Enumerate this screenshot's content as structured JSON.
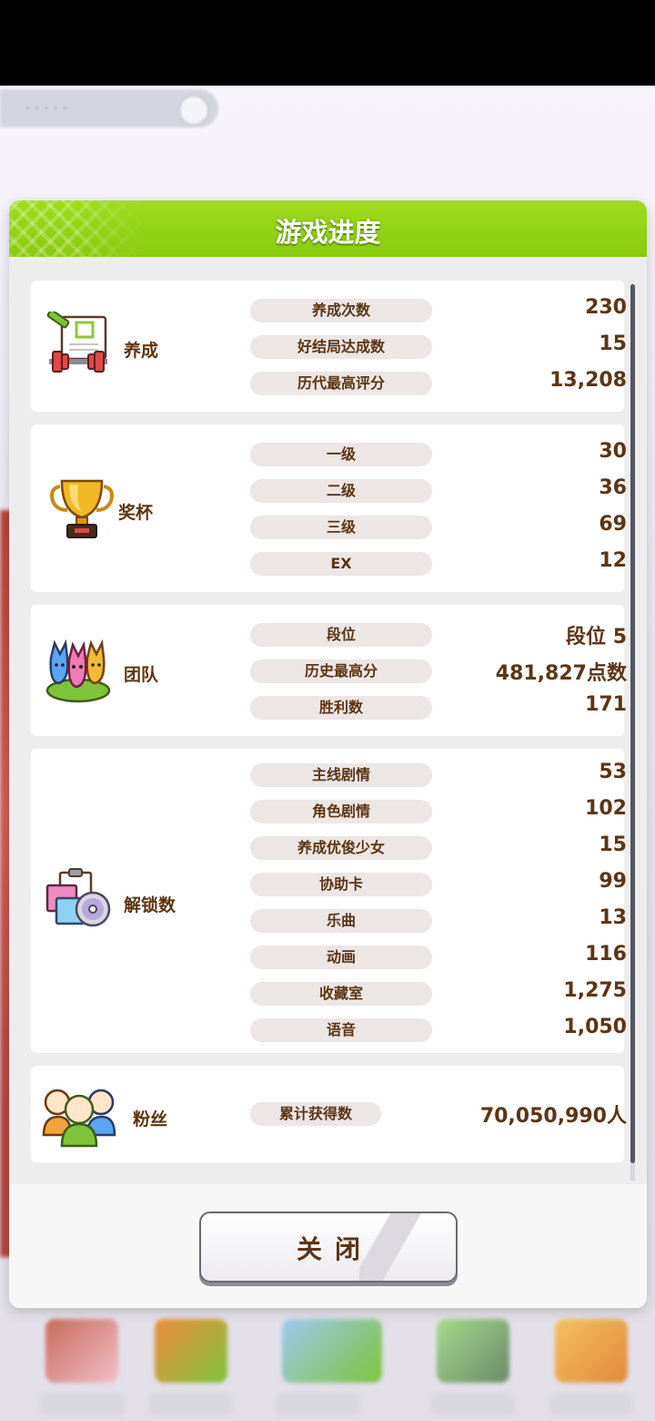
{
  "modal": {
    "title": "游戏进度",
    "close_label": "关闭"
  },
  "sections": [
    {
      "id": "training",
      "label": "养成",
      "icon": "training-icon",
      "rows": [
        {
          "label": "养成次数",
          "value": "230"
        },
        {
          "label": "好结局达成数",
          "value": "15"
        },
        {
          "label": "历代最高评分",
          "value": "13,208"
        }
      ]
    },
    {
      "id": "trophy",
      "label": "奖杯",
      "icon": "trophy-icon",
      "rows": [
        {
          "label": "一级",
          "value": "30"
        },
        {
          "label": "二级",
          "value": "36"
        },
        {
          "label": "三级",
          "value": "69"
        },
        {
          "label": "EX",
          "value": "12"
        }
      ]
    },
    {
      "id": "team",
      "label": "团队",
      "icon": "team-icon",
      "rows": [
        {
          "label": "段位",
          "value": "段位 5"
        },
        {
          "label": "历史最高分",
          "value": "481,827点数"
        },
        {
          "label": "胜利数",
          "value": "171"
        }
      ]
    },
    {
      "id": "unlocks",
      "label": "解锁数",
      "icon": "unlock-icon",
      "rows": [
        {
          "label": "主线剧情",
          "value": "53"
        },
        {
          "label": "角色剧情",
          "value": "102"
        },
        {
          "label": "养成优俊少女",
          "value": "15"
        },
        {
          "label": "协助卡",
          "value": "99"
        },
        {
          "label": "乐曲",
          "value": "13"
        },
        {
          "label": "动画",
          "value": "116"
        },
        {
          "label": "收藏室",
          "value": "1,275"
        },
        {
          "label": "语音",
          "value": "1,050"
        }
      ]
    },
    {
      "id": "fans",
      "label": "粉丝",
      "icon": "fans-icon",
      "rows": [
        {
          "label": "累计获得数",
          "value": "70,050,990人"
        }
      ]
    }
  ],
  "colors": {
    "header_green": "#8fd314",
    "text_brown": "#5a3515",
    "label_pill": "#ece6e5"
  }
}
